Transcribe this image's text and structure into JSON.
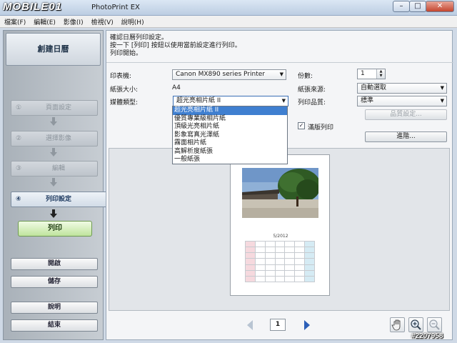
{
  "window": {
    "logo": "MOBILE01",
    "title": "PhotoPrint EX",
    "controls": {
      "minimize": "–",
      "maximize": "□",
      "close": "✕"
    }
  },
  "menu": [
    "檔案(F)",
    "編輯(E)",
    "影像(I)",
    "檢視(V)",
    "說明(H)"
  ],
  "sidebar": {
    "header": "創建日曆",
    "steps": [
      {
        "num": "①",
        "label": "頁面設定",
        "active": false
      },
      {
        "num": "②",
        "label": "選擇影像",
        "active": false
      },
      {
        "num": "③",
        "label": "編輯",
        "active": false
      },
      {
        "num": "④",
        "label": "列印設定",
        "active": true
      }
    ],
    "print_button": "列印",
    "buttons": {
      "open": "開啟",
      "save": "儲存",
      "help": "說明",
      "exit": "結束"
    }
  },
  "instructions": [
    "確認日曆列印設定。",
    "按一下 [列印] 按鈕以使用當前設定進行列印。",
    "列印開始。"
  ],
  "settings": {
    "printer": {
      "label": "印表機:",
      "value": "Canon MX890 series Printer"
    },
    "paper_size": {
      "label": "紙張大小:",
      "value": "A4"
    },
    "media_type": {
      "label": "媒體類型:",
      "value": "超光亮相片紙 II",
      "options": [
        "超光亮相片紙 II",
        "優質專業級相片紙",
        "頂級光亮相片紙",
        "影象寫真光澤紙",
        "霧面相片紙",
        "高解析度紙張",
        "一般紙張"
      ],
      "selected_index": 0
    },
    "copies": {
      "label": "份數:",
      "value": "1"
    },
    "paper_source": {
      "label": "紙張來源:",
      "value": "自動選取"
    },
    "print_quality": {
      "label": "列印品質:",
      "value": "標準"
    },
    "quality_settings_button": "品質設定...",
    "borderless": {
      "label": "滿版列印",
      "checked": true
    },
    "advanced_button": "進階..."
  },
  "preview": {
    "calendar_title": "5/2012"
  },
  "pager": {
    "page": "1"
  },
  "watermark": "#2207958"
}
